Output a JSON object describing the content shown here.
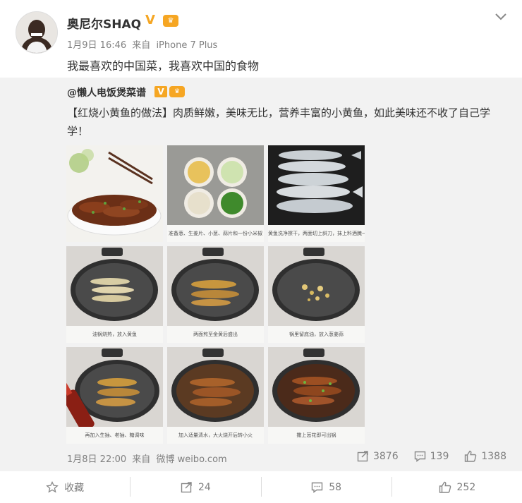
{
  "post": {
    "user_name": "奥尼尔SHAQ",
    "date": "1月9日 16:46",
    "source_prefix": "来自",
    "source": "iPhone 7 Plus",
    "text": "我最喜欢的中国菜，我喜欢中国的食物"
  },
  "repost": {
    "author": "@懒人电饭煲菜谱",
    "text": "【红烧小黄鱼的做法】肉质鲜嫩，美味无比，营养丰富的小黄鱼，如此美味还不收了自己学学！",
    "captions": [
      "",
      "准备葱、生姜片、小葱、蒜片和一份小米椒",
      "黄鱼洗净擦干，两面切上斜刀，抹上料酒腌一下",
      "油锅烧热，放入黄鱼",
      "两面煎至金黄后盛出",
      "锅里留底油，放入葱姜蒜",
      "再加入生抽、老抽、糖调味",
      "加入适量清水，大火烧开后转小火",
      "撒上葱花即可出锅"
    ],
    "date": "1月8日 22:00",
    "source_prefix": "来自",
    "source": "微博 weibo.com",
    "reposts": "3876",
    "comments": "139",
    "likes": "1388"
  },
  "footer": {
    "favorite_label": "收藏",
    "reposts": "24",
    "comments": "58",
    "likes": "252"
  },
  "colors": {
    "verified": "#f5a623",
    "text": "#333333",
    "muted": "#808080",
    "repost_bg": "#f2f2f2"
  }
}
